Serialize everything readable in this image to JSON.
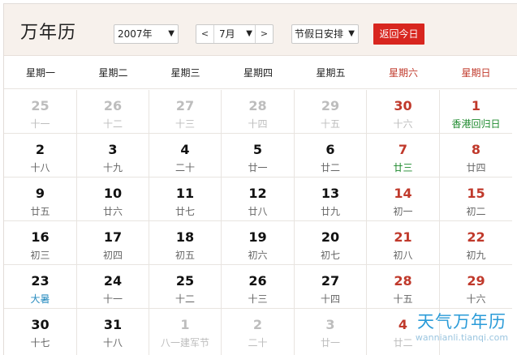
{
  "app": {
    "title": "万年历",
    "year_select": "2007年",
    "month_prev": "<",
    "month_value": "7月",
    "month_next": ">",
    "holiday_select": "节假日安排",
    "today_button": "返回今日"
  },
  "weekdays": [
    "星期一",
    "星期二",
    "星期三",
    "星期四",
    "星期五",
    "星期六",
    "星期日"
  ],
  "weeks": [
    [
      {
        "day": "25",
        "lunar": "十一",
        "other": true
      },
      {
        "day": "26",
        "lunar": "十二",
        "other": true
      },
      {
        "day": "27",
        "lunar": "十三",
        "other": true
      },
      {
        "day": "28",
        "lunar": "十四",
        "other": true
      },
      {
        "day": "29",
        "lunar": "十五",
        "other": true
      },
      {
        "day": "30",
        "lunar": "十六",
        "other": true
      },
      {
        "day": "1",
        "lunar": "香港回归日",
        "highlight": "green"
      }
    ],
    [
      {
        "day": "2",
        "lunar": "十八"
      },
      {
        "day": "3",
        "lunar": "十九"
      },
      {
        "day": "4",
        "lunar": "二十"
      },
      {
        "day": "5",
        "lunar": "廿一"
      },
      {
        "day": "6",
        "lunar": "廿二"
      },
      {
        "day": "7",
        "lunar": "廿三",
        "highlight": "green"
      },
      {
        "day": "8",
        "lunar": "廿四"
      }
    ],
    [
      {
        "day": "9",
        "lunar": "廿五"
      },
      {
        "day": "10",
        "lunar": "廿六"
      },
      {
        "day": "11",
        "lunar": "廿七"
      },
      {
        "day": "12",
        "lunar": "廿八"
      },
      {
        "day": "13",
        "lunar": "廿九"
      },
      {
        "day": "14",
        "lunar": "初一"
      },
      {
        "day": "15",
        "lunar": "初二"
      }
    ],
    [
      {
        "day": "16",
        "lunar": "初三"
      },
      {
        "day": "17",
        "lunar": "初四"
      },
      {
        "day": "18",
        "lunar": "初五"
      },
      {
        "day": "19",
        "lunar": "初六"
      },
      {
        "day": "20",
        "lunar": "初七"
      },
      {
        "day": "21",
        "lunar": "初八"
      },
      {
        "day": "22",
        "lunar": "初九"
      }
    ],
    [
      {
        "day": "23",
        "lunar": "大暑",
        "highlight": "blue"
      },
      {
        "day": "24",
        "lunar": "十一"
      },
      {
        "day": "25",
        "lunar": "十二"
      },
      {
        "day": "26",
        "lunar": "十三"
      },
      {
        "day": "27",
        "lunar": "十四"
      },
      {
        "day": "28",
        "lunar": "十五"
      },
      {
        "day": "29",
        "lunar": "十六"
      }
    ],
    [
      {
        "day": "30",
        "lunar": "十七"
      },
      {
        "day": "31",
        "lunar": "十八"
      },
      {
        "day": "1",
        "lunar": "八一建军节",
        "other": true
      },
      {
        "day": "2",
        "lunar": "二十",
        "other": true
      },
      {
        "day": "3",
        "lunar": "廿一",
        "other": true
      },
      {
        "day": "4",
        "lunar": "廿二",
        "other": true
      },
      {
        "day": "",
        "lunar": "",
        "other": true
      }
    ]
  ],
  "watermark": {
    "text": "天气万年历",
    "url": "wannianli.tianqi.com"
  },
  "colors": {
    "weekend_red": "#c0392b",
    "today_button": "#d8261f",
    "holiday_green": "#1e8a2e",
    "solar_term_blue": "#2a8dc0",
    "header_bg": "#f7f1ec"
  }
}
